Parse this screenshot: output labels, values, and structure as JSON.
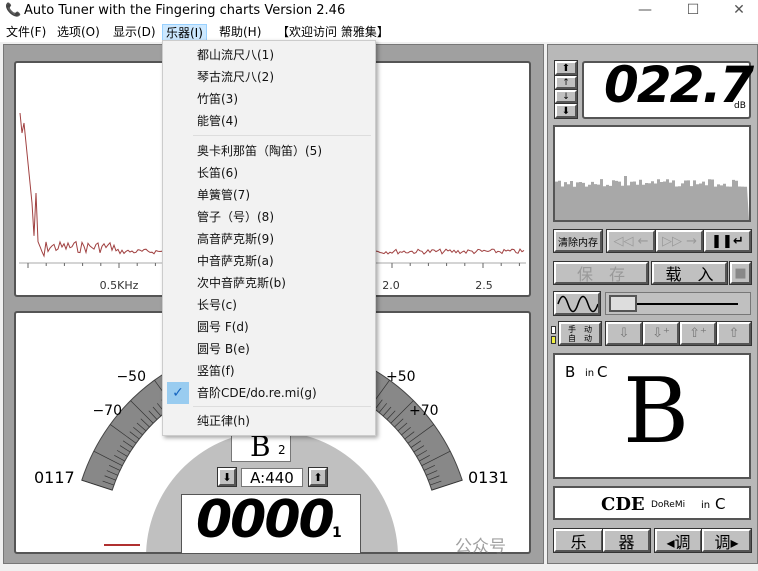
{
  "window": {
    "title": "Auto Tuner with the Fingering charts  Version 2.46",
    "minimize": "—",
    "maximize": "☐",
    "close": "✕"
  },
  "menubar": [
    "文件(F)",
    "选项(O)",
    "显示(D)",
    "乐器(I)",
    "帮助(H)",
    "【欢迎访问 箫雅集】"
  ],
  "dropdown": {
    "items": [
      {
        "label": "都山流尺八(1)"
      },
      {
        "label": "琴古流尺八(2)"
      },
      {
        "label": "竹笛(3)"
      },
      {
        "label": "能管(4)"
      },
      {
        "label": "奥卡利那笛（陶笛）(5)"
      },
      {
        "label": "长笛(6)"
      },
      {
        "label": "单簧管(7)"
      },
      {
        "label": "管子（号）(8)"
      },
      {
        "label": "高音萨克斯(9)"
      },
      {
        "label": "中音萨克斯(a)"
      },
      {
        "label": "次中音萨克斯(b)"
      },
      {
        "label": "长号(c)"
      },
      {
        "label": "圆号 F(d)"
      },
      {
        "label": "圆号 B(e)"
      },
      {
        "label": "竖笛(f)"
      },
      {
        "label": "音阶CDE/do.re.mi(g)",
        "checked": true
      },
      {
        "label": "纯正律(h)"
      }
    ],
    "check": "✓"
  },
  "spectrum": {
    "ticks": [
      "0.5KHz",
      "2.0",
      "2.5"
    ],
    "line_color": "#a04040"
  },
  "gauge": {
    "labels": {
      "m50": "−50",
      "m70": "−70",
      "p50": "+50",
      "p70": "+70",
      "left": "0117",
      "right": "0131"
    },
    "note": "B",
    "octave": "2",
    "a_ref": "A:440",
    "freq": "0000",
    "freq_suffix": "1"
  },
  "level": {
    "value": "022.7",
    "unit": "dB"
  },
  "controls": {
    "clear": "清除内存",
    "rewind": "◁◁ ←",
    "forward": "▷▷ →",
    "pause": "❚❚↵",
    "save": "保　存",
    "load": "载　入",
    "manual": "手　动",
    "auto": "自　动"
  },
  "note_display": {
    "note": "B",
    "in": "in",
    "key": "C",
    "big": "B"
  },
  "scale_display": {
    "cde": "CDE",
    "doremi": "DoReMi",
    "in": "in",
    "key": "C"
  },
  "bottom": {
    "instr1": "乐",
    "instr2": "器",
    "key_down": "◂调",
    "key_up": "调▸"
  },
  "watermark": "公众号"
}
